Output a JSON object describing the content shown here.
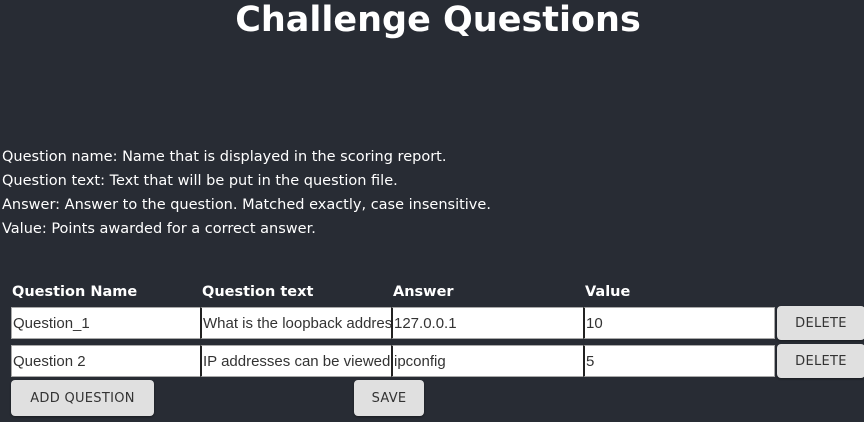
{
  "page_title": "Challenge Questions",
  "descriptions": [
    "Question name: Name that is displayed in the scoring report.",
    "Question text: Text that will be put in the question file.",
    "Answer: Answer to the question. Matched exactly, case insensitive.",
    "Value: Points awarded for a correct answer."
  ],
  "table": {
    "headers": {
      "name": "Question Name",
      "text": "Question text",
      "answer": "Answer",
      "value": "Value"
    },
    "rows": [
      {
        "name": "Question_1",
        "text": "What is the loopback address?",
        "answer": "127.0.0.1",
        "value": "10",
        "delete_label": "DELETE"
      },
      {
        "name": "Question 2",
        "text": "IP addresses can be viewed with what command?",
        "answer": "ipconfig",
        "value": "5",
        "delete_label": "DELETE"
      }
    ]
  },
  "actions": {
    "add_question_label": "ADD QUESTION",
    "save_label": "SAVE"
  },
  "colors": {
    "background": "#282c34",
    "text": "#ffffff",
    "button_bg": "#e0e0e0"
  }
}
